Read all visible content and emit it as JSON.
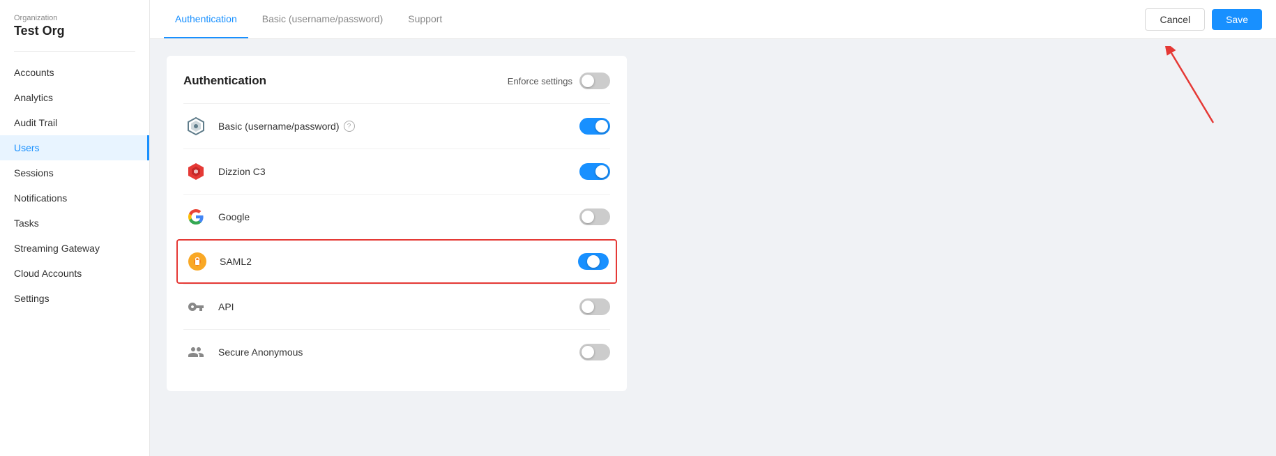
{
  "sidebar": {
    "org_label": "Organization",
    "org_name": "Test Org",
    "items": [
      {
        "id": "accounts",
        "label": "Accounts",
        "active": false
      },
      {
        "id": "analytics",
        "label": "Analytics",
        "active": false
      },
      {
        "id": "audit-trail",
        "label": "Audit Trail",
        "active": false
      },
      {
        "id": "users",
        "label": "Users",
        "active": true
      },
      {
        "id": "sessions",
        "label": "Sessions",
        "active": false
      },
      {
        "id": "notifications",
        "label": "Notifications",
        "active": false
      },
      {
        "id": "tasks",
        "label": "Tasks",
        "active": false
      },
      {
        "id": "streaming-gateway",
        "label": "Streaming Gateway",
        "active": false
      },
      {
        "id": "cloud-accounts",
        "label": "Cloud Accounts",
        "active": false
      },
      {
        "id": "settings",
        "label": "Settings",
        "active": false
      }
    ]
  },
  "topbar": {
    "tabs": [
      {
        "id": "authentication",
        "label": "Authentication",
        "active": true
      },
      {
        "id": "basic",
        "label": "Basic (username/password)",
        "active": false
      },
      {
        "id": "support",
        "label": "Support",
        "active": false
      }
    ],
    "cancel_label": "Cancel",
    "save_label": "Save"
  },
  "auth_card": {
    "title": "Authentication",
    "enforce_label": "Enforce settings",
    "rows": [
      {
        "id": "basic",
        "label": "Basic (username/password)",
        "has_help": true,
        "toggle": "on"
      },
      {
        "id": "dizzion",
        "label": "Dizzion C3",
        "has_help": false,
        "toggle": "on"
      },
      {
        "id": "google",
        "label": "Google",
        "has_help": false,
        "toggle": "off"
      },
      {
        "id": "saml2",
        "label": "SAML2",
        "has_help": false,
        "toggle": "transitioning",
        "highlighted": true
      },
      {
        "id": "api",
        "label": "API",
        "has_help": false,
        "toggle": "off"
      },
      {
        "id": "secure-anon",
        "label": "Secure Anonymous",
        "has_help": false,
        "toggle": "off"
      }
    ]
  }
}
